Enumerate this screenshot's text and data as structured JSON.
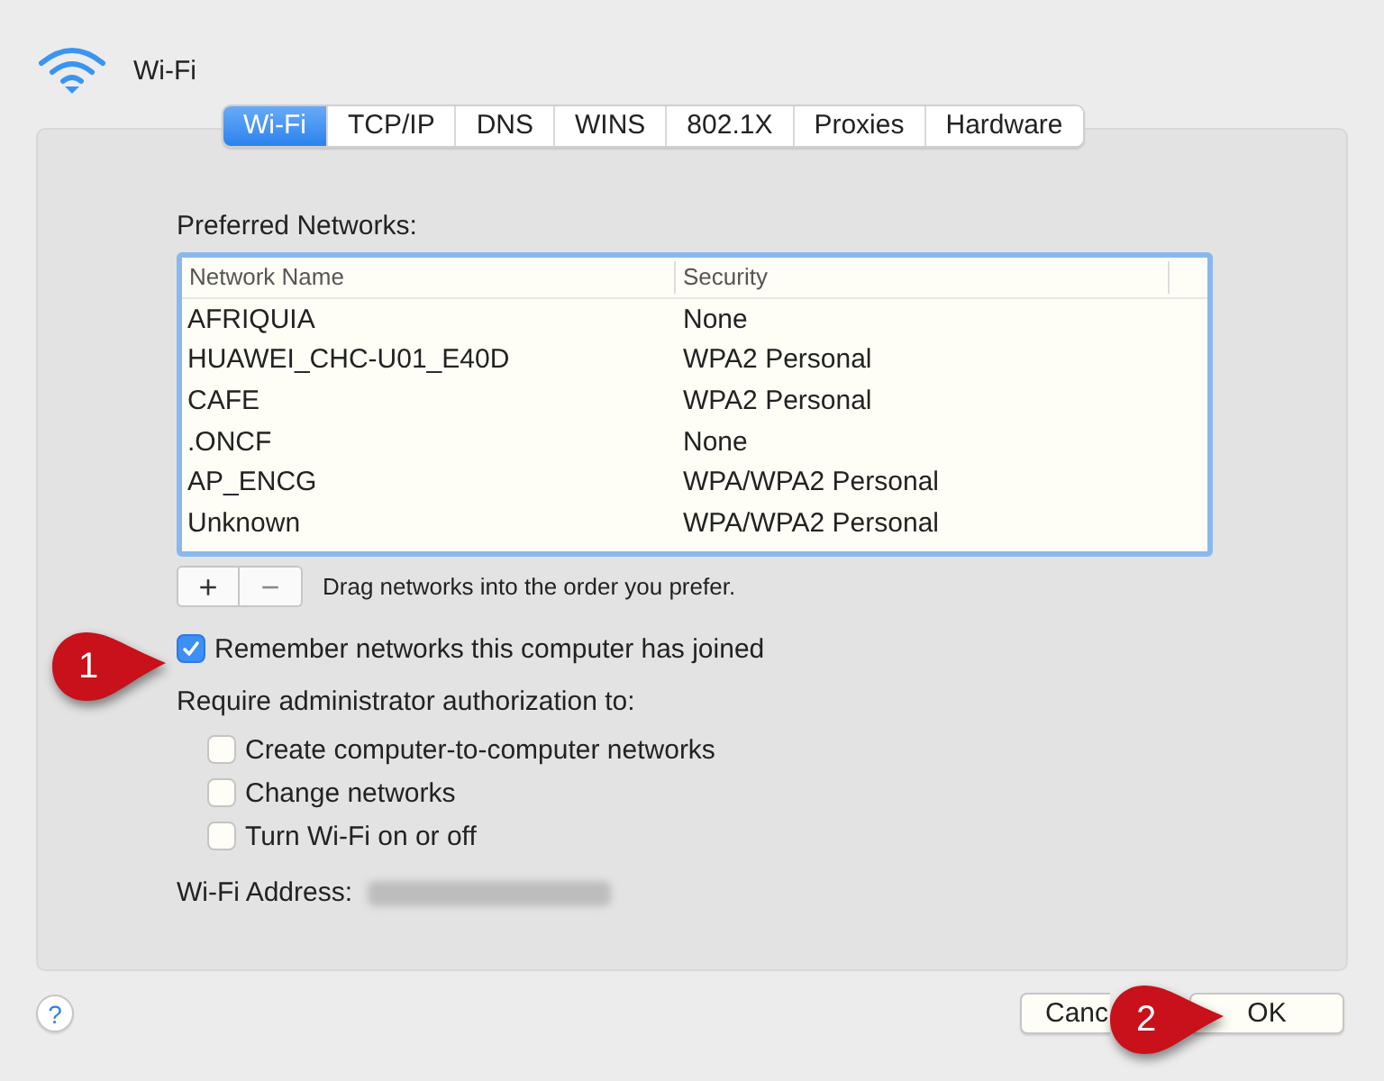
{
  "header": {
    "title": "Wi-Fi"
  },
  "tabs": [
    {
      "label": "Wi-Fi",
      "selected": true
    },
    {
      "label": "TCP/IP",
      "selected": false
    },
    {
      "label": "DNS",
      "selected": false
    },
    {
      "label": "WINS",
      "selected": false
    },
    {
      "label": "802.1X",
      "selected": false
    },
    {
      "label": "Proxies",
      "selected": false
    },
    {
      "label": "Hardware",
      "selected": false
    }
  ],
  "preferred_networks": {
    "label": "Preferred Networks:",
    "columns": [
      "Network Name",
      "Security"
    ],
    "rows": [
      [
        "AFRIQUIA",
        "None"
      ],
      [
        "HUAWEI_CHC-U01_E40D",
        "WPA2 Personal"
      ],
      [
        "CAFE",
        "WPA2 Personal"
      ],
      [
        ".ONCF",
        "None"
      ],
      [
        "AP_ENCG",
        "WPA/WPA2 Personal"
      ],
      [
        "Unknown",
        "WPA/WPA2 Personal"
      ]
    ],
    "add_button": "+",
    "remove_button": {
      "label": "−",
      "disabled": true
    },
    "hint": "Drag networks into the order you prefer."
  },
  "remember": {
    "label": "Remember networks this computer has joined",
    "checked": true
  },
  "require_label": "Require administrator authorization to:",
  "require_options": [
    {
      "label": "Create computer-to-computer networks",
      "checked": false
    },
    {
      "label": "Change networks",
      "checked": false
    },
    {
      "label": "Turn Wi-Fi on or off",
      "checked": false
    }
  ],
  "address_label": "Wi-Fi Address:",
  "help_button": "?",
  "buttons": [
    {
      "label": "Canc",
      "kind": "secondary"
    },
    {
      "label": "OK",
      "kind": "primary"
    }
  ],
  "callouts": [
    {
      "number": "1"
    },
    {
      "number": "2"
    }
  ]
}
